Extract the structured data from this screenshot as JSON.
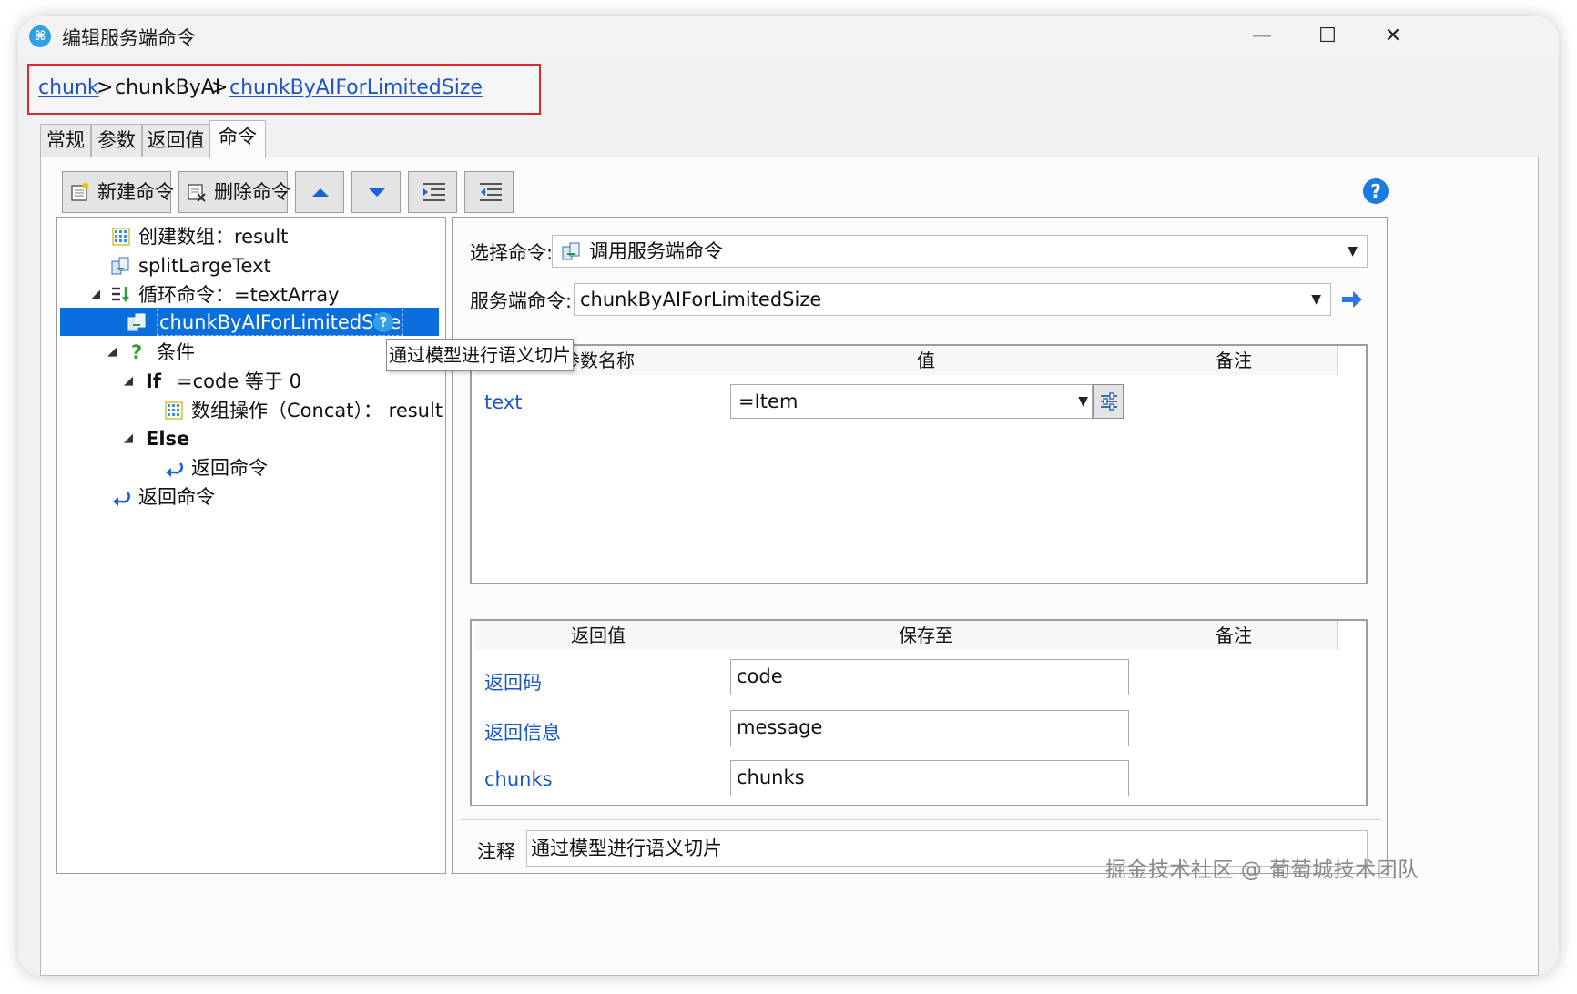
{
  "window": {
    "title": "编辑服务端命令",
    "app_icon": "app-logo-icon",
    "controls": [
      "minimize-icon",
      "maximize-icon",
      "close-icon"
    ]
  },
  "breadcrumb": {
    "items": [
      {
        "label": "chunk",
        "link": true
      },
      {
        "label": "chunkByAI",
        "link": false
      },
      {
        "label": "chunkByAIForLimitedSize",
        "link": true
      }
    ],
    "separator": ">"
  },
  "tabs": [
    {
      "label": "常规",
      "active": false
    },
    {
      "label": "参数",
      "active": false
    },
    {
      "label": "返回值",
      "active": false
    },
    {
      "label": "命令",
      "active": true
    }
  ],
  "toolbar": {
    "new_command": "新建命令",
    "delete_command": "删除命令",
    "move_up_icon": "arrow-up-icon",
    "move_down_icon": "arrow-down-icon",
    "indent_icon": "indent-icon",
    "outdent_icon": "outdent-icon",
    "help_icon": "help-icon"
  },
  "tree": {
    "items": [
      {
        "label": "创建数组：result",
        "icon": "array-icon"
      },
      {
        "label": "splitLargeText",
        "icon": "server-command-icon"
      },
      {
        "label": "循环命令：=textArray",
        "icon": "loop-icon",
        "expanded": true
      },
      {
        "label": "chunkByAIForLimitedSize",
        "icon": "server-command-icon",
        "selected": true
      },
      {
        "label": "条件",
        "icon": "condition-icon",
        "expanded": true
      },
      {
        "label": "If",
        "detail": "=code 等于 0",
        "expanded": true
      },
      {
        "label": "数组操作（Concat）： result",
        "icon": "array-icon"
      },
      {
        "label": "Else",
        "expanded": true
      },
      {
        "label": "返回命令",
        "icon": "return-icon"
      },
      {
        "label": "返回命令",
        "icon": "return-icon"
      }
    ],
    "tooltip": "通过模型进行语义切片"
  },
  "detail": {
    "select_command_label": "选择命令:",
    "select_command_value": "调用服务端命令",
    "server_command_label": "服务端命令:",
    "server_command_value": "chunkByAIForLimitedSize",
    "params": {
      "headers": [
        "参数名称",
        "值",
        "备注"
      ],
      "rows": [
        {
          "name": "text",
          "value": "=Item",
          "note": ""
        }
      ]
    },
    "returns": {
      "headers": [
        "返回值",
        "保存至",
        "备注"
      ],
      "rows": [
        {
          "name": "返回码",
          "value": "code"
        },
        {
          "name": "返回信息",
          "value": "message"
        },
        {
          "name": "chunks",
          "value": "chunks"
        }
      ]
    },
    "comment_label": "注释",
    "comment_value": "通过模型进行语义切片"
  },
  "colors": {
    "accent": "#0a6edc",
    "link": "#1a56c8",
    "highlight_border": "#e02828"
  },
  "watermark": "掘金技术社区 @ 葡萄城技术团队"
}
